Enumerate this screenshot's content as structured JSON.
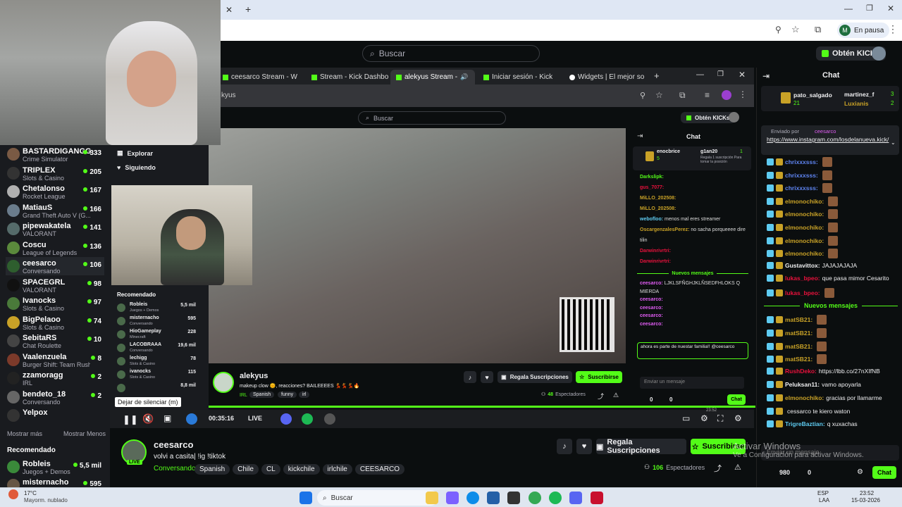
{
  "browser": {
    "profile_label": "En pausa",
    "profile_initial": "M"
  },
  "kick": {
    "search_placeholder": "Buscar",
    "kicks_button": "Obtén KICKs"
  },
  "sidebar": {
    "channels": [
      {
        "name": "BASTARDIGANGG",
        "category": "Crime Simulator",
        "viewers": "333",
        "color": "#7a5a44"
      },
      {
        "name": "TRIPLEX",
        "category": "Slots & Casino",
        "viewers": "205",
        "color": "#333"
      },
      {
        "name": "Chetalonso",
        "category": "Rocket League",
        "viewers": "167",
        "color": "#b0b0b0"
      },
      {
        "name": "MatiauS",
        "category": "Grand Theft Auto V (G...",
        "viewers": "166",
        "color": "#6a7c8c"
      },
      {
        "name": "pipewakatela",
        "category": "VALORANT",
        "viewers": "141",
        "color": "#556b6a"
      },
      {
        "name": "Coscu",
        "category": "League of Legends",
        "viewers": "136",
        "color": "#5b8a3c"
      },
      {
        "name": "ceesarco",
        "category": "Conversando",
        "viewers": "106",
        "color": "#2e5e2e"
      },
      {
        "name": "SPACEGRL",
        "category": "VALORANT",
        "viewers": "98",
        "color": "#111"
      },
      {
        "name": "Ivanocks",
        "category": "Slots & Casino",
        "viewers": "97",
        "color": "#4a7a3a"
      },
      {
        "name": "BigPelaoo",
        "category": "Slots & Casino",
        "viewers": "74",
        "color": "#c9a227"
      },
      {
        "name": "SebitaRS",
        "category": "Chat Roulette",
        "viewers": "10",
        "color": "#444"
      },
      {
        "name": "Vaalenzuela",
        "category": "Burger Shift: Team Rush...",
        "viewers": "8",
        "color": "#7c3a2a"
      },
      {
        "name": "zzamoragg",
        "category": "IRL",
        "viewers": "2",
        "color": "#222"
      },
      {
        "name": "bendeto_18",
        "category": "Conversando",
        "viewers": "2",
        "color": "#666"
      },
      {
        "name": "Yelpox",
        "category": "",
        "viewers": "",
        "color": "#333"
      }
    ],
    "show_more": "Mostrar más",
    "show_less": "Mostrar Menos",
    "recommended_title": "Recomendado",
    "recommended": [
      {
        "name": "Robleis",
        "category": "Juegos + Demos",
        "viewers": "5,5 mil"
      },
      {
        "name": "misternacho",
        "category": "",
        "viewers": "595"
      }
    ],
    "nav": [
      {
        "label": "Explorar"
      },
      {
        "label": "Siguiendo"
      }
    ]
  },
  "inner_browser": {
    "tabs": [
      {
        "label": "ceesarco Stream - W"
      },
      {
        "label": "Stream - Kick Dashbo"
      },
      {
        "label": "alekyus Stream -"
      },
      {
        "label": "Iniciar sesión - Kick"
      },
      {
        "label": "Widgets | El mejor so"
      }
    ],
    "url": "kyus",
    "search_placeholder": "Buscar",
    "kicks_button": "Obtén KICKs",
    "recommended_title": "Recomendado",
    "recommended": [
      {
        "name": "Robleis",
        "category": "Juegos + Demos",
        "viewers": "5,5 mil"
      },
      {
        "name": "misternacho",
        "category": "Conversando",
        "viewers": "595"
      },
      {
        "name": "HioGameplay",
        "category": "Minecraft",
        "viewers": "228"
      },
      {
        "name": "LACOBRAAA",
        "category": "Conversando",
        "viewers": "19,6 mil"
      },
      {
        "name": "lechigg",
        "category": "Slots & Casino",
        "viewers": "78"
      },
      {
        "name": "ivanocks",
        "category": "Slots & Casino",
        "viewers": "115"
      },
      {
        "name": "",
        "category": "",
        "viewers": "8,8 mil"
      }
    ],
    "streamer": "alekyus",
    "title": "makeup clow 🌞, reacciones? BAILEEEES 💃💃💃🔥",
    "category": "IRL",
    "tags": [
      "Spanish",
      "funny",
      "irl"
    ],
    "gift_button": "Regala Suscripciones",
    "subscribe_button": "Suscribirse",
    "viewers": "48",
    "viewers_label": "Espectadores",
    "chat_title": "Chat",
    "leader1": "enocbrice",
    "leader1_count": "5",
    "leader2": "g1an20",
    "leader2_count": "1",
    "leader2_note": "Regala 1 suscripción Para tomar la posición",
    "chat": [
      {
        "user": "Darkslipk:",
        "text": ""
      },
      {
        "user": "gus_7077:",
        "text": ""
      },
      {
        "user": "MiLLO_202508:",
        "text": ""
      },
      {
        "user": "MiLLO_202508:",
        "text": ""
      },
      {
        "user": "webofloo:",
        "text": "menos mal eres streamer"
      },
      {
        "user": "OscargenzalesPerez:",
        "text": "no sacha porqueeee dire"
      },
      {
        "user": "",
        "text": "tilin"
      },
      {
        "user": "Darwinrivrtri:",
        "text": ""
      },
      {
        "user": "Darwinrivrtri:",
        "text": ""
      }
    ],
    "new_messages": "Nuevos mensajes",
    "chat2": [
      {
        "user": "ceesarco:",
        "text": "LJKLSFÑGHJKLÑSEDFHLOKS Q"
      },
      {
        "user": "",
        "text": "MIERDA"
      },
      {
        "user": "ceesarco:",
        "text": ""
      },
      {
        "user": "ceesarco:",
        "text": ""
      },
      {
        "user": "ceesarco:",
        "text": ""
      },
      {
        "user": "ceesarco:",
        "text": ""
      }
    ],
    "sub_notice": "ahora es parte de nuestar familia!! @ceesarco",
    "chat_input_placeholder": "Enviar un mensaje",
    "chat_button": "Chat",
    "counts": [
      "0",
      "0"
    ],
    "time": "23:52",
    "date": "15-03-2026"
  },
  "tooltip": "Dejar de silenciar (m)",
  "player": {
    "elapsed": "00:35:16",
    "live": "LIVE"
  },
  "stream": {
    "streamer": "ceesarco",
    "live_badge": "LIVE",
    "title": "volvi a casita| !ig !tiktok",
    "category": "Conversando",
    "tags": [
      "Spanish",
      "Chile",
      "CL",
      "kickchile",
      "irlchile",
      "CEESARCO"
    ],
    "gift_button": "Regala Suscripciones",
    "subscribe_button": "Suscribirse",
    "viewers": "106",
    "viewers_label": "Espectadores",
    "activate_windows": "Activar Windows",
    "activate_windows_sub": "Ve a Configuración para activar Windows."
  },
  "chat": {
    "title": "Chat",
    "leader1": "pato_salgado",
    "leader1_count": "21",
    "leader2": "martinez_f",
    "leader2_count": "3",
    "leader3": "Luxianis",
    "leader3_count": "2",
    "pinned_by_label": "Enviado por",
    "pinned_by": "ceesarco",
    "pinned_link": "https://www.instagram.com/losdelanueva.kick/",
    "messages": [
      {
        "user": "chrixxxsss:",
        "text": "",
        "color": "#5e84f1"
      },
      {
        "user": "chrixxxsss:",
        "text": "",
        "color": "#5e84f1"
      },
      {
        "user": "chrixxxsss:",
        "text": "",
        "color": "#5e84f1"
      },
      {
        "user": "elmonochiko:",
        "text": "",
        "color": "#c9a227"
      },
      {
        "user": "elmonochiko:",
        "text": "",
        "color": "#c9a227"
      },
      {
        "user": "elmonochiko:",
        "text": "",
        "color": "#c9a227"
      },
      {
        "user": "elmonochiko:",
        "text": "",
        "color": "#c9a227"
      },
      {
        "user": "elmonochiko:",
        "text": "",
        "color": "#c9a227"
      },
      {
        "user": "Gustavittox:",
        "text": "JAJAJAJAJA",
        "color": "#efeff1"
      },
      {
        "user": "lukas_bpeo:",
        "text": "que pasa mimor Cesarito",
        "color": "#e9113c"
      },
      {
        "user": "lukas_bpeo:",
        "text": "",
        "color": "#e9113c"
      }
    ],
    "new_messages": "Nuevos mensajes",
    "messages2": [
      {
        "user": "matSB21:",
        "text": "",
        "color": "#c9a227"
      },
      {
        "user": "matSB21:",
        "text": "",
        "color": "#c9a227"
      },
      {
        "user": "matSB21:",
        "text": "",
        "color": "#c9a227"
      },
      {
        "user": "matSB21:",
        "text": "",
        "color": "#c9a227"
      },
      {
        "user": "RushDeko:",
        "text": "https://lbb.co/27nXIfNB",
        "color": "#e9113c"
      },
      {
        "user": "Peluksan11:",
        "text": "vamo apoyarla",
        "color": "#efeff1"
      },
      {
        "user": "elmonochiko:",
        "text": "gracias por llamarme",
        "color": "#c9a227"
      },
      {
        "user": "",
        "text": "cessarco te kiero waton",
        "color": "#efeff1"
      },
      {
        "user": "TrigreBaztian:",
        "text": "q xuxachas",
        "color": "#5ecbf1"
      }
    ],
    "input_placeholder": "Enviar un mensaje",
    "points": "980",
    "counter": "0",
    "chat_button": "Chat"
  },
  "taskbar": {
    "weather_temp": "17°C",
    "weather_desc": "Mayorm. nublado",
    "search_placeholder": "Buscar",
    "lang": "ESP",
    "lang_sub": "LAA",
    "time": "23:52",
    "date": "15-03-2026"
  },
  "colors": {
    "accent": "#53fc18",
    "background": "#0b0e0f",
    "panel": "#191b1f"
  }
}
